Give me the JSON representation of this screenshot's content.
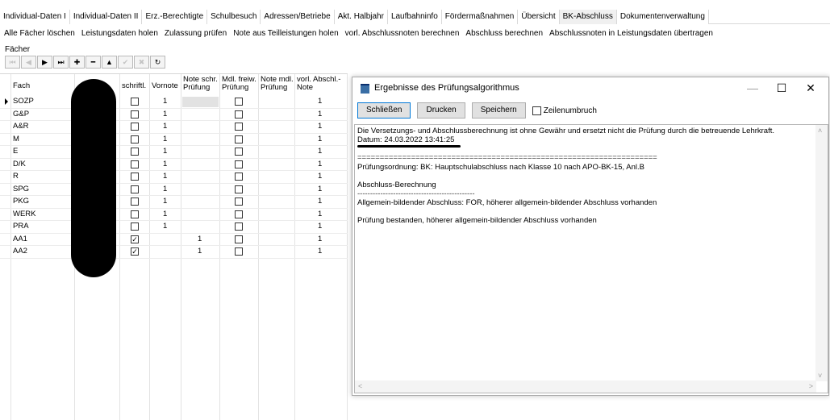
{
  "tabs": [
    "Individual-Daten I",
    "Individual-Daten II",
    "Erz.-Berechtigte",
    "Schulbesuch",
    "Adressen/Betriebe",
    "Akt. Halbjahr",
    "Laufbahninfo",
    "Fördermaßnahmen",
    "Übersicht",
    "BK-Abschluss",
    "Dokumentenverwaltung"
  ],
  "active_tab": "BK-Abschluss",
  "actions": [
    "Alle Fächer löschen",
    "Leistungsdaten holen",
    "Zulassung prüfen",
    "Note aus Teilleistungen holen",
    "vorl. Abschlussnoten berechnen",
    "Abschluss berechnen",
    "Abschlussnoten in Leistungsdaten übertragen"
  ],
  "section_label": "Fächer",
  "navigator": {
    "buttons": [
      {
        "name": "first-record-icon",
        "glyph": "⏮",
        "enabled": false
      },
      {
        "name": "prior-record-icon",
        "glyph": "◀",
        "enabled": false
      },
      {
        "name": "next-record-icon",
        "glyph": "▶",
        "enabled": true
      },
      {
        "name": "last-record-icon",
        "glyph": "⏭",
        "enabled": true
      },
      {
        "name": "insert-record-icon",
        "glyph": "✚",
        "enabled": true
      },
      {
        "name": "delete-record-icon",
        "glyph": "━",
        "enabled": true
      },
      {
        "name": "edit-record-icon",
        "glyph": "▲",
        "enabled": true
      },
      {
        "name": "post-record-icon",
        "glyph": "✔",
        "enabled": false
      },
      {
        "name": "cancel-record-icon",
        "glyph": "✖",
        "enabled": false
      },
      {
        "name": "refresh-record-icon",
        "glyph": "↻",
        "enabled": true
      }
    ]
  },
  "grid": {
    "headers": {
      "fach": "Fach",
      "schriftl": "schriftl.",
      "vornote": "Vornote",
      "note_schr": [
        "Note schr.",
        "Prüfung"
      ],
      "mdl_freiw": [
        "Mdl. freiw.",
        "Prüfung"
      ],
      "note_mdl": [
        "Note mdl.",
        "Prüfung"
      ],
      "vorl_abschl": [
        "vorl. Abschl.-",
        "Note"
      ]
    },
    "rows": [
      {
        "fach": "SOZP",
        "schriftl": false,
        "vornote": "1",
        "note_schr": "",
        "mdl": false,
        "note_mdl": "",
        "vorl": "1",
        "current": true
      },
      {
        "fach": "G&P",
        "schriftl": false,
        "vornote": "1",
        "note_schr": "",
        "mdl": false,
        "note_mdl": "",
        "vorl": "1"
      },
      {
        "fach": "A&R",
        "schriftl": false,
        "vornote": "1",
        "note_schr": "",
        "mdl": false,
        "note_mdl": "",
        "vorl": "1"
      },
      {
        "fach": "M",
        "schriftl": false,
        "vornote": "1",
        "note_schr": "",
        "mdl": false,
        "note_mdl": "",
        "vorl": "1"
      },
      {
        "fach": "E",
        "schriftl": false,
        "vornote": "1",
        "note_schr": "",
        "mdl": false,
        "note_mdl": "",
        "vorl": "1"
      },
      {
        "fach": "D/K",
        "schriftl": false,
        "vornote": "1",
        "note_schr": "",
        "mdl": false,
        "note_mdl": "",
        "vorl": "1"
      },
      {
        "fach": "R",
        "schriftl": false,
        "vornote": "1",
        "note_schr": "",
        "mdl": false,
        "note_mdl": "",
        "vorl": "1"
      },
      {
        "fach": "SPG",
        "schriftl": false,
        "vornote": "1",
        "note_schr": "",
        "mdl": false,
        "note_mdl": "",
        "vorl": "1"
      },
      {
        "fach": "PKG",
        "schriftl": false,
        "vornote": "1",
        "note_schr": "",
        "mdl": false,
        "note_mdl": "",
        "vorl": "1"
      },
      {
        "fach": "WERK",
        "schriftl": false,
        "vornote": "1",
        "note_schr": "",
        "mdl": false,
        "note_mdl": "",
        "vorl": "1"
      },
      {
        "fach": "PRA",
        "schriftl": false,
        "vornote": "1",
        "note_schr": "",
        "mdl": false,
        "note_mdl": "",
        "vorl": "1"
      },
      {
        "fach": "AA1",
        "schriftl": true,
        "vornote": "",
        "note_schr": "1",
        "mdl": false,
        "note_mdl": "",
        "vorl": "1"
      },
      {
        "fach": "AA2",
        "schriftl": true,
        "vornote": "",
        "note_schr": "1",
        "mdl": false,
        "note_mdl": "",
        "vorl": "1"
      }
    ]
  },
  "dialog": {
    "title": "Ergebnisse des Prüfungsalgorithmus",
    "controls": {
      "minimize": "—",
      "maximize": "☐",
      "close": "✕"
    },
    "buttons": {
      "close": "Schließen",
      "print": "Drucken",
      "save": "Speichern"
    },
    "wrap_label": "Zeilenumbruch",
    "wrap_checked": false,
    "lines": [
      "Die Versetzungs- und Abschlussberechnung ist ohne Gewähr und ersetzt nicht die Prüfung durch die betreuende Lehrkraft.",
      "Datum: 24.03.2022 13:41:25",
      "===================================================================",
      "Prüfungsordnung: BK: Hauptschulabschluss nach Klasse 10 nach APO-BK-15, Anl.B",
      "Abschluss-Berechnung",
      "----------------------------------------------",
      "Allgemein-bildender Abschluss: FOR, höherer allgemein-bildender Abschluss vorhanden",
      "Prüfung bestanden, höherer allgemein-bildender Abschluss vorhanden"
    ]
  }
}
